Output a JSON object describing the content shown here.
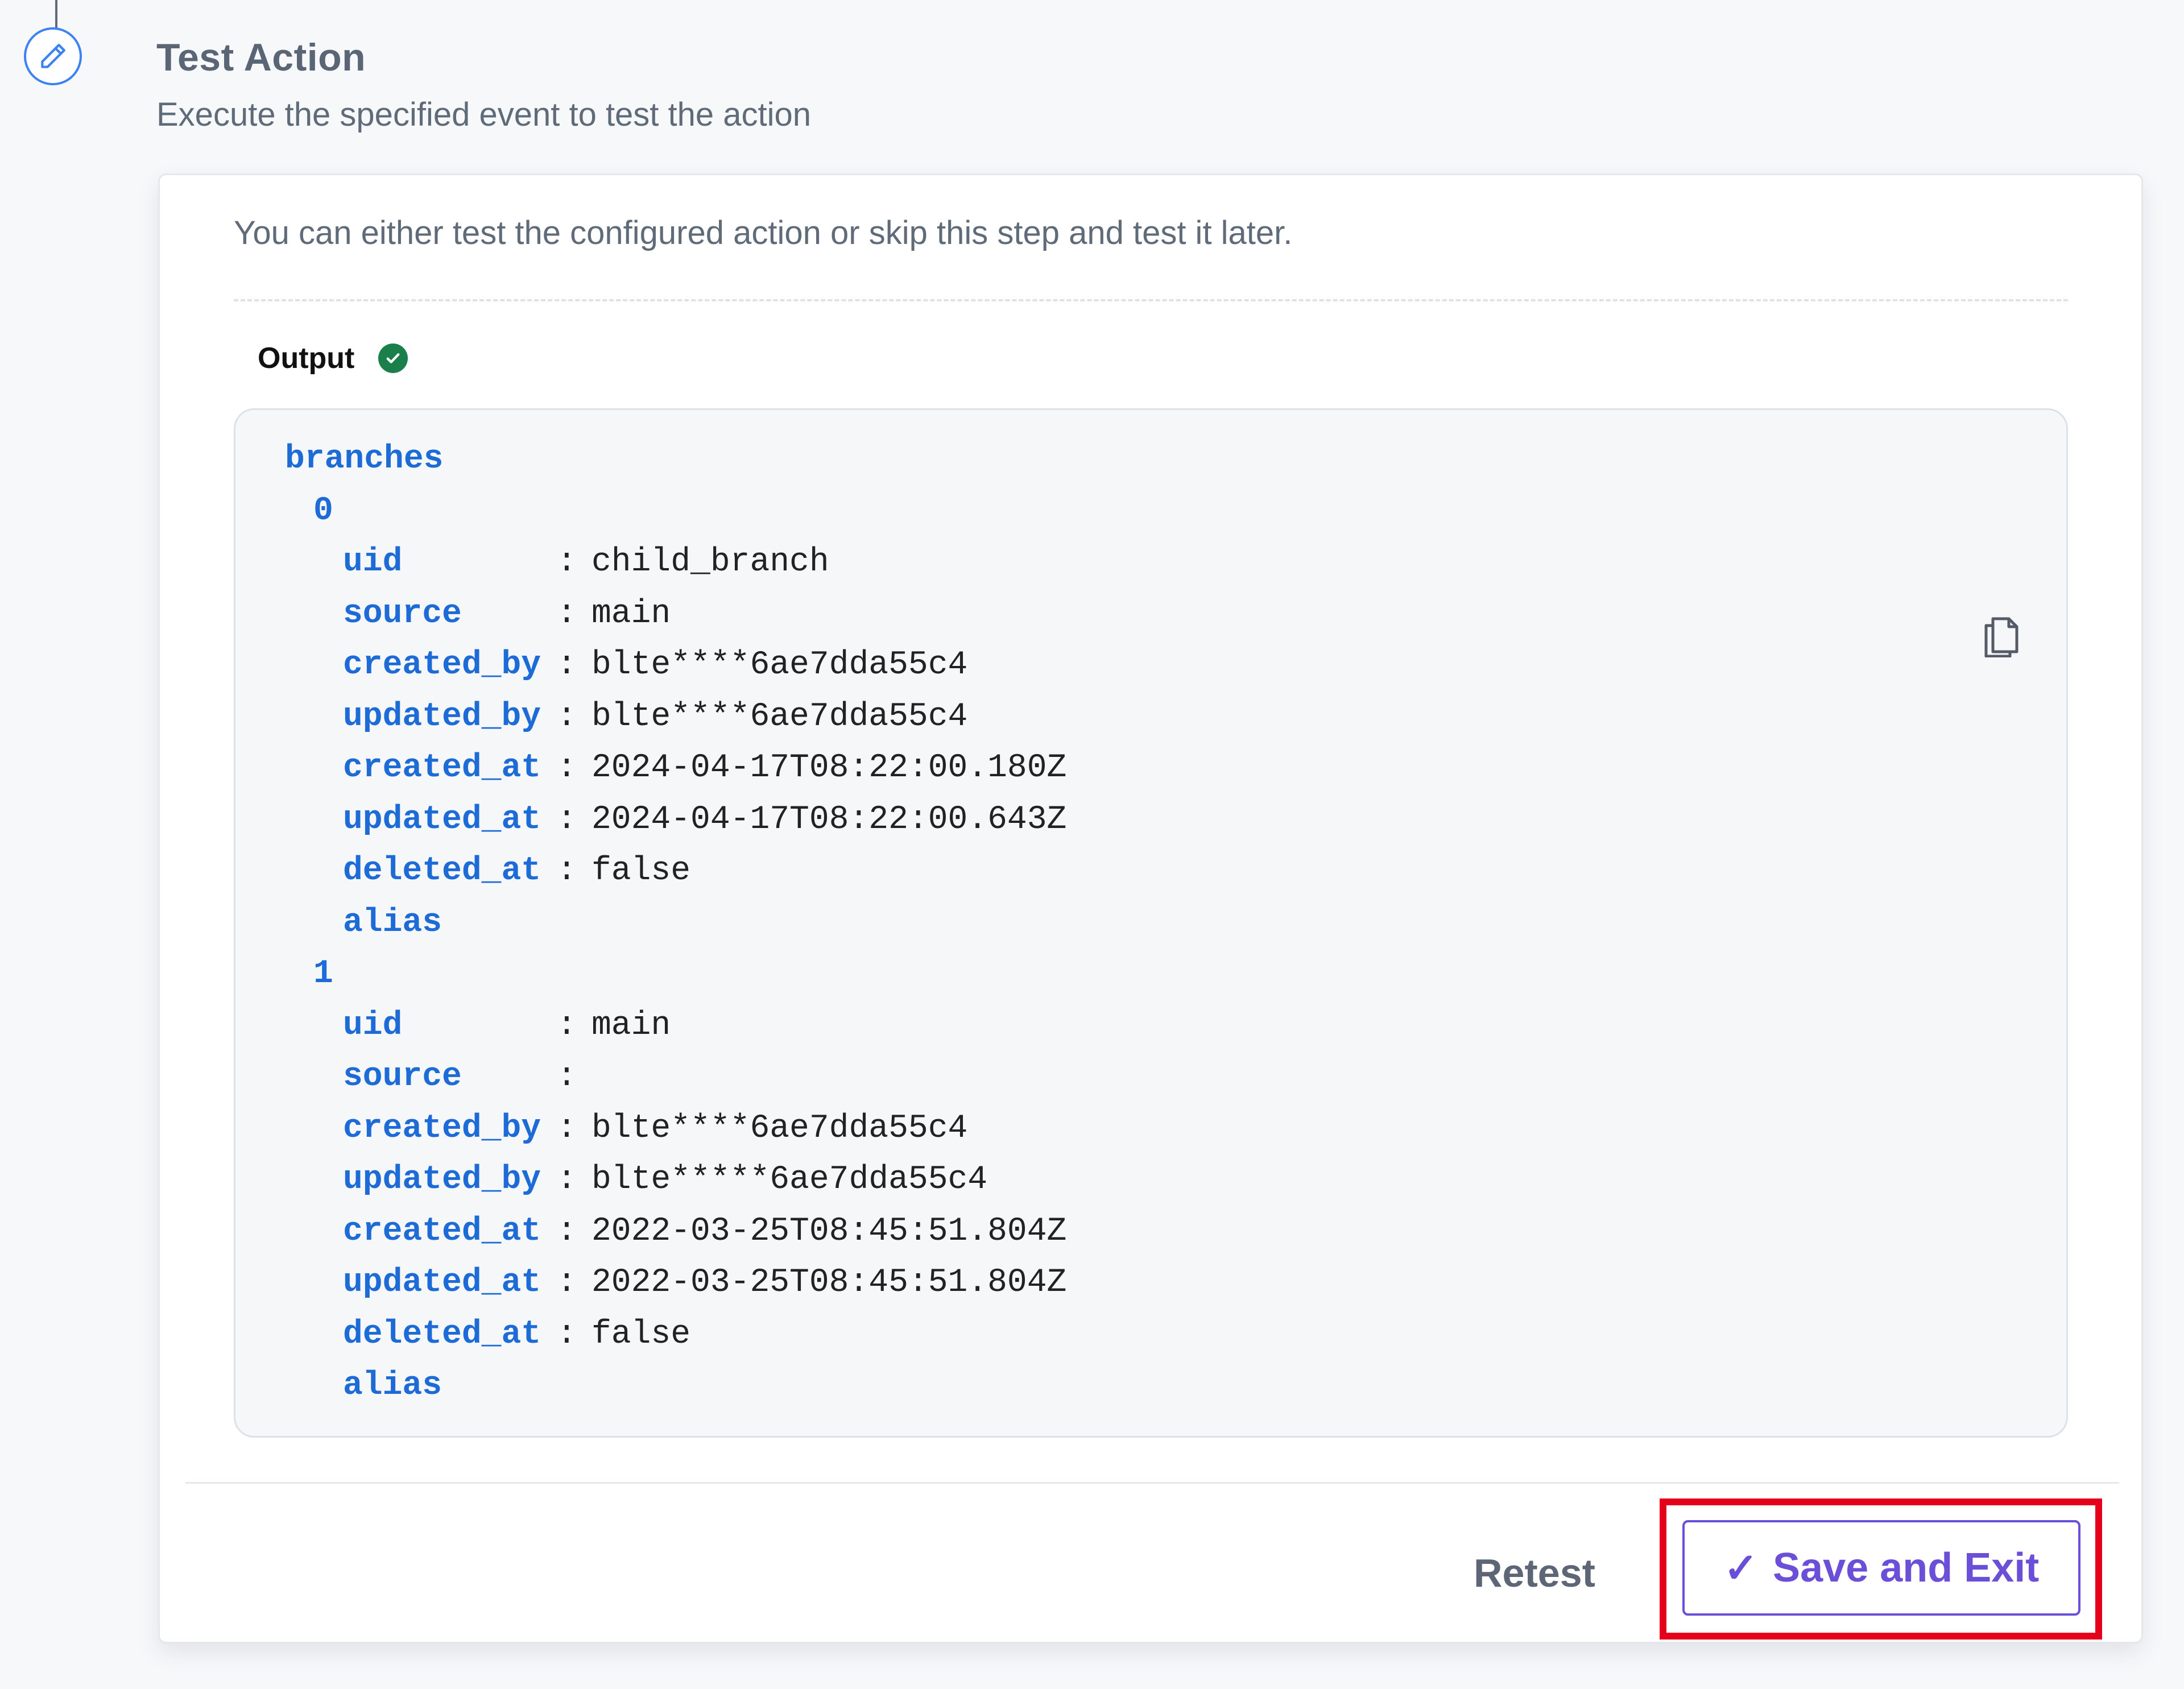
{
  "step": {
    "title": "Test Action",
    "subtitle": "Execute the specified event to test the action",
    "icon": "pencil-icon"
  },
  "card": {
    "description": "You can either test the configured action or skip this step and test it later.",
    "output_label": "Output",
    "output_status_icon": "check-circle-icon",
    "copy_icon": "copy-icon"
  },
  "output": {
    "root_key": "branches",
    "items": [
      {
        "index": "0",
        "fields": [
          {
            "key": "uid",
            "value": "child_branch"
          },
          {
            "key": "source",
            "value": "main"
          },
          {
            "key": "created_by",
            "value": "blte****6ae7dda55c4"
          },
          {
            "key": "updated_by",
            "value": "blte****6ae7dda55c4"
          },
          {
            "key": "created_at",
            "value": "2024-04-17T08:22:00.180Z"
          },
          {
            "key": "updated_at",
            "value": "2024-04-17T08:22:00.643Z"
          },
          {
            "key": "deleted_at",
            "value": "false"
          }
        ],
        "trailing_key": "alias"
      },
      {
        "index": "1",
        "fields": [
          {
            "key": "uid",
            "value": "main"
          },
          {
            "key": "source",
            "value": ""
          },
          {
            "key": "created_by",
            "value": "blte****6ae7dda55c4"
          },
          {
            "key": "updated_by",
            "value": "blte*****6ae7dda55c4"
          },
          {
            "key": "created_at",
            "value": "2022-03-25T08:45:51.804Z"
          },
          {
            "key": "updated_at",
            "value": "2022-03-25T08:45:51.804Z"
          },
          {
            "key": "deleted_at",
            "value": "false"
          }
        ],
        "trailing_key": "alias"
      }
    ]
  },
  "footer": {
    "retest_label": "Retest",
    "save_label": "Save and Exit",
    "save_icon": "checkmark-icon"
  },
  "colors": {
    "key": "#1d6bd6",
    "accent": "#6b4fd8",
    "success": "#1a7f4b",
    "highlight": "#e5001c"
  }
}
